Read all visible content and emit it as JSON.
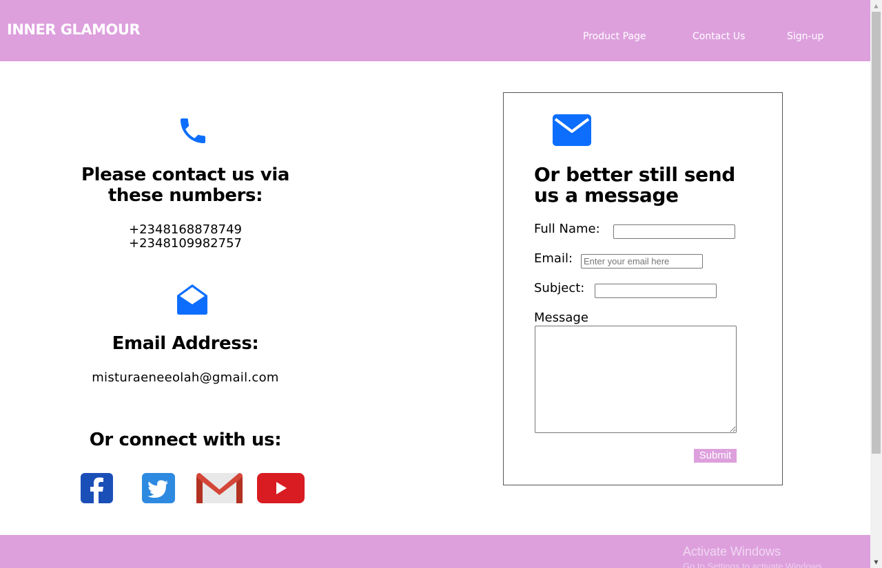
{
  "brand": "INNER GLAMOUR",
  "nav": [
    "Product Page",
    "Contact Us",
    "Sign-up"
  ],
  "contact": {
    "phone_heading": "Please contact us via these numbers:",
    "phones": [
      "+2348168878749",
      "+2348109982757"
    ],
    "email_heading": "Email Address:",
    "email": "misturaeneeolah@gmail.com",
    "connect_heading": "Or connect with us:",
    "social_icons": [
      "facebook-icon",
      "twitter-icon",
      "gmail-icon",
      "youtube-icon"
    ]
  },
  "form": {
    "heading": "Or better still send us a message",
    "full_name_label": "Full Name:",
    "full_name_value": "",
    "email_label": "Email:",
    "email_value": "",
    "email_placeholder": "Enter your email here",
    "subject_label": "Subject:",
    "subject_value": "",
    "message_label": "Message",
    "message_value": "",
    "submit_label": "Submit"
  },
  "watermark": {
    "line1": "Activate Windows",
    "line2": "Go to Settings to activate Windows."
  },
  "colors": {
    "brand": "#dda0dd",
    "icon_blue": "#0d6efd",
    "white": "#ffffff"
  }
}
